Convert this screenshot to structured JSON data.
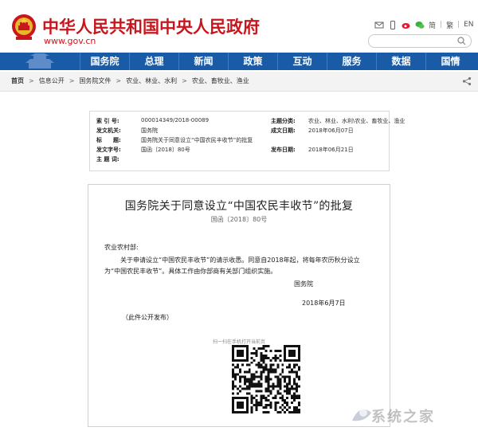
{
  "header": {
    "site_title": "中华人民共和国中央人民政府",
    "site_url": "www.gov.cn",
    "lang_simplified": "简",
    "lang_traditional": "繁",
    "lang_english": "EN",
    "search_placeholder": ""
  },
  "nav": {
    "items": [
      "国务院",
      "总理",
      "新闻",
      "政策",
      "互动",
      "服务",
      "数据",
      "国情"
    ]
  },
  "breadcrumb": {
    "items": [
      "首页",
      "信息公开",
      "国务院文件",
      "农业、林业、水利",
      "农业、畜牧业、渔业"
    ]
  },
  "meta": {
    "index_label": "索 引 号:",
    "index_value": "000014349/2018-00089",
    "category_label": "主题分类:",
    "category_value": "农业、林业、水利\\农业、畜牧业、渔业",
    "issuer_label": "发文机关:",
    "issuer_value": "国务院",
    "created_label": "成文日期:",
    "created_value": "2018年06月07日",
    "title_label": "标　　题:",
    "title_value": "国务院关于同意设立“中国农民丰收节”的批复",
    "docnum_label": "发文字号:",
    "docnum_value": "国函〔2018〕80号",
    "published_label": "发布日期:",
    "published_value": "2018年06月21日",
    "keywords_label": "主 题 词:",
    "keywords_value": ""
  },
  "document": {
    "title": "国务院关于同意设立“中国农民丰收节”的批复",
    "number": "国函〔2018〕80号",
    "addressee": "农业农村部:",
    "para1_line1": "关于申请设立“中国农民丰收节”的请示收悉。同意自2018年起，将每年农历秋分设立",
    "para1_line2": "为“中国农民丰收节”。具体工作由你部商有关部门组织实施。",
    "signature": "国务院",
    "date": "2018年6月7日",
    "public_note": "（此件公开发布）",
    "qr_caption": "扫一扫在手机打开当前页"
  },
  "watermark": {
    "text": "系统之家"
  },
  "colors": {
    "brand_red": "#c8161d",
    "nav_blue": "#1a5ba8"
  }
}
